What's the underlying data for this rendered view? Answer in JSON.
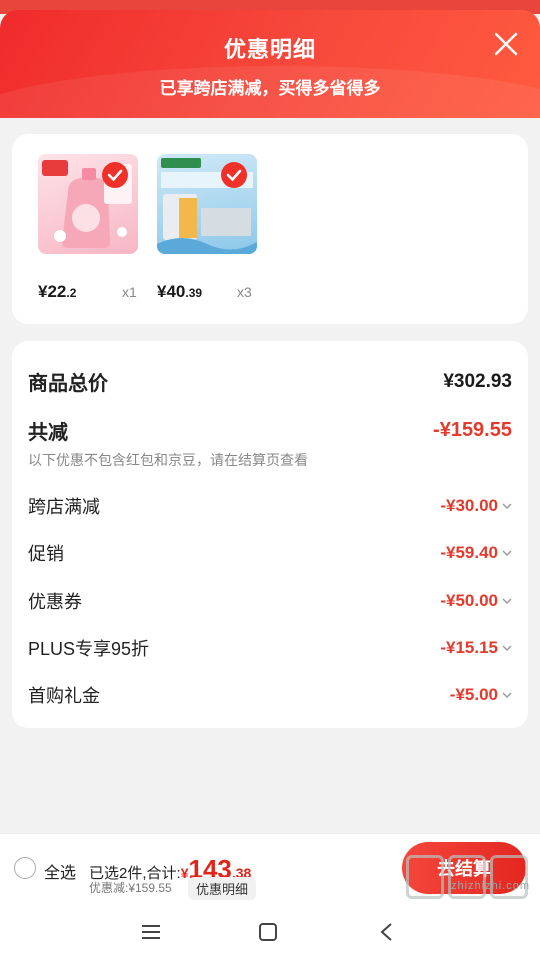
{
  "header": {
    "title": "优惠明细",
    "subtitle": "已享跨店满减，买得多省得多"
  },
  "products": [
    {
      "price_main": "¥22",
      "price_dec": ".2",
      "qty": "x1",
      "icon": "detergent-bottle-image"
    },
    {
      "price_main": "¥40",
      "price_dec": ".39",
      "qty": "x3",
      "icon": "beer-case-image"
    }
  ],
  "details": {
    "total_label": "商品总价",
    "total_value": "¥302.93",
    "reduce_label": "共减",
    "reduce_value": "-¥159.55",
    "note": "以下优惠不包含红包和京豆，请在结算页查看",
    "items": [
      {
        "label": "跨店满减",
        "value": "-¥30.00"
      },
      {
        "label": "促销",
        "value": "-¥59.40"
      },
      {
        "label": "优惠券",
        "value": "-¥50.00"
      },
      {
        "label": "PLUS专享95折",
        "value": "-¥15.15"
      },
      {
        "label": "首购礼金",
        "value": "-¥5.00"
      }
    ]
  },
  "bottom": {
    "select_all": "全选",
    "summary_prefix": "已选2件,合计:",
    "yen": "¥",
    "amount_int": "143",
    "amount_dec": ".38",
    "discount_line": "优惠减:¥159.55",
    "detail_button": "优惠明细",
    "checkout_button": "去结算"
  },
  "watermark": "zhizhizhi.com",
  "colors": {
    "accent": "#e2231a",
    "header": "#f02b2b"
  }
}
